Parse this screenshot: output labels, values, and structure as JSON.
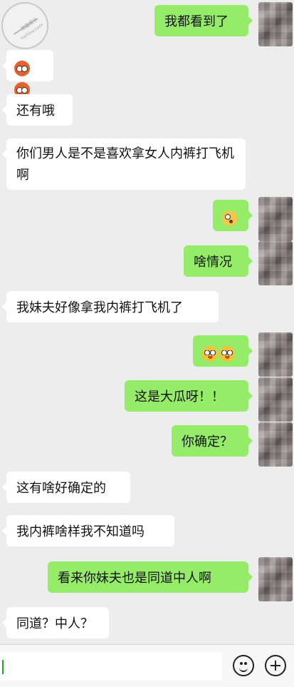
{
  "messages": [
    {
      "side": "out",
      "text": "我都看到了"
    },
    {
      "side": "in",
      "emoji": "red-faces"
    },
    {
      "side": "in",
      "text": "还有哦"
    },
    {
      "side": "in",
      "text": "你们男人是不是喜欢拿女人内裤打飞机啊"
    },
    {
      "side": "out",
      "emoji": "shock-face"
    },
    {
      "side": "out",
      "text": "啥情况"
    },
    {
      "side": "in",
      "text": "我妹夫好像拿我内裤打飞机了"
    },
    {
      "side": "out",
      "emoji": "yellow-faces"
    },
    {
      "side": "out",
      "text": "这是大瓜呀！！"
    },
    {
      "side": "out",
      "text": "你确定？"
    },
    {
      "side": "in",
      "text": "这有啥好确定的"
    },
    {
      "side": "in",
      "text": "我内裤啥样我不知道吗"
    },
    {
      "side": "out",
      "text": "看来你妹夫也是同道中人啊"
    },
    {
      "side": "in",
      "text": "同道？中人？"
    }
  ],
  "watermark": {
    "line1": "海量娱乐",
    "line2": "haiilixa.com"
  },
  "inputbar": {
    "emoji_button": "emoji-button",
    "plus_button": "plus-button"
  }
}
